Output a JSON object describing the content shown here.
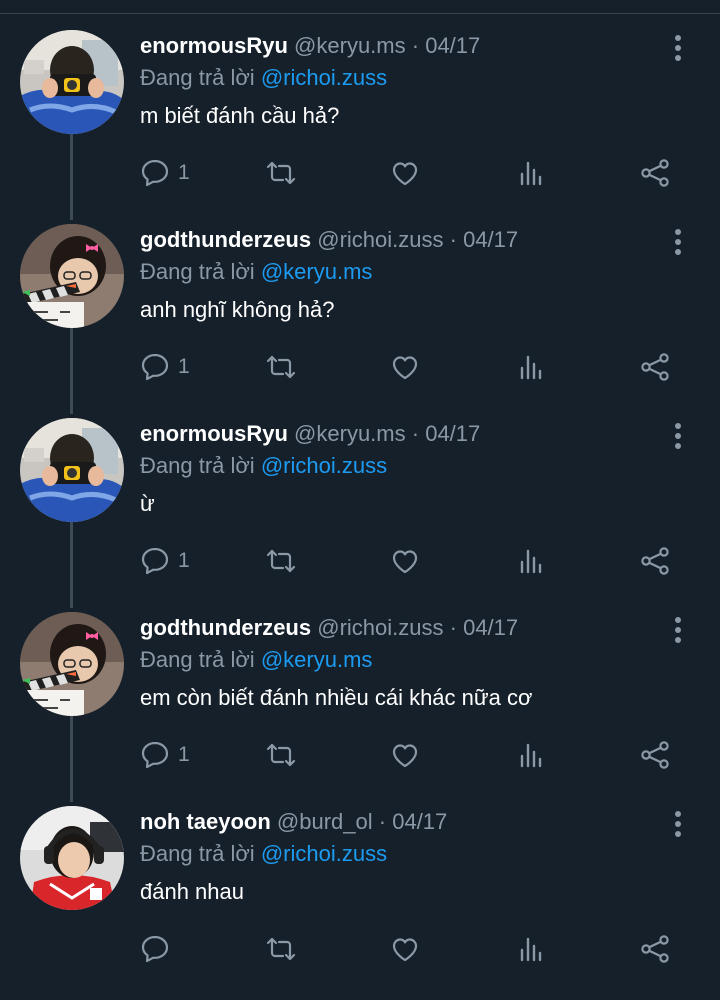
{
  "colors": {
    "background": "#15202b",
    "text": "#ffffff",
    "muted": "#8b98a5",
    "link": "#1d9bf0",
    "divider": "#38444d"
  },
  "icons": [
    "more-vertical-icon",
    "reply-icon",
    "retweet-icon",
    "like-icon",
    "views-icon",
    "share-icon"
  ],
  "tweets": [
    {
      "name": "enormousRyu",
      "handle": "@keryu.ms",
      "separator": "·",
      "date": "04/17",
      "reply_prefix": "Đang trả lời",
      "reply_to": "@richoi.zuss",
      "text": "m biết đánh cầu hả?",
      "reply_count": "1"
    },
    {
      "name": "godthunderzeus",
      "handle": "@richoi.zuss",
      "separator": "·",
      "date": "04/17",
      "reply_prefix": "Đang trả lời",
      "reply_to": "@keryu.ms",
      "text": "anh nghĩ không hả?",
      "reply_count": "1"
    },
    {
      "name": "enormousRyu",
      "handle": "@keryu.ms",
      "separator": "·",
      "date": "04/17",
      "reply_prefix": "Đang trả lời",
      "reply_to": "@richoi.zuss",
      "text": "ừ",
      "reply_count": "1"
    },
    {
      "name": "godthunderzeus",
      "handle": "@richoi.zuss",
      "separator": "·",
      "date": "04/17",
      "reply_prefix": "Đang trả lời",
      "reply_to": "@keryu.ms",
      "text": "em còn biết đánh nhiều cái khác nữa cơ",
      "reply_count": "1"
    },
    {
      "name": "noh taeyoon",
      "handle": "@burd_ol",
      "separator": "·",
      "date": "04/17",
      "reply_prefix": "Đang trả lời",
      "reply_to": "@richoi.zuss",
      "text": "đánh nhau",
      "reply_count": ""
    }
  ]
}
